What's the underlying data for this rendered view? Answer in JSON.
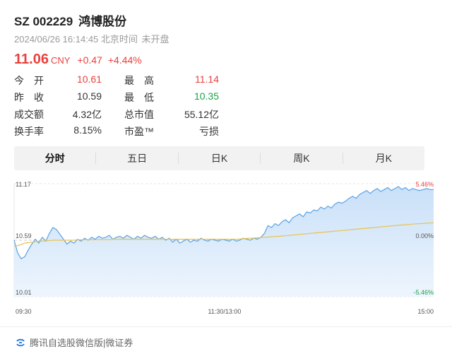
{
  "stock": {
    "code": "SZ 002229",
    "name": "鸿博股份",
    "timestamp": "2024/06/26 16:14:45 北京时间",
    "market_status": "未开盘",
    "price": "11.06",
    "currency": "CNY",
    "change": "+0.47",
    "change_pct": "+4.44%"
  },
  "stats": [
    {
      "label1": "今开",
      "value1": "10.61",
      "label2": "最高",
      "value2": "11.14"
    },
    {
      "label1": "昨收",
      "value1": "10.59",
      "label2": "最低",
      "value2": "10.35"
    },
    {
      "label1": "成交额",
      "value1": "4.32亿",
      "label2": "总市值",
      "value2": "55.12亿"
    },
    {
      "label1": "换手率",
      "value1": "8.15%",
      "label2": "市盈™",
      "value2": "亏损"
    }
  ],
  "tabs": [
    {
      "label": "分时",
      "active": true
    },
    {
      "label": "五日",
      "active": false
    },
    {
      "label": "日K",
      "active": false
    },
    {
      "label": "周K",
      "active": false
    },
    {
      "label": "月K",
      "active": false
    }
  ],
  "chart_data": {
    "type": "area",
    "y_left_ticks": [
      "11.17",
      "10.59",
      "10.01"
    ],
    "y_right_ticks": [
      "5.46%",
      "0.00%",
      "-5.46%"
    ],
    "x_ticks": [
      "09:30",
      "11:30/13:00",
      "15:00"
    ],
    "ylim": [
      10.01,
      11.17
    ],
    "price_series": [
      10.59,
      10.46,
      10.4,
      10.42,
      10.49,
      10.55,
      10.6,
      10.56,
      10.62,
      10.58,
      10.66,
      10.72,
      10.7,
      10.65,
      10.6,
      10.55,
      10.58,
      10.56,
      10.6,
      10.58,
      10.61,
      10.59,
      10.62,
      10.6,
      10.63,
      10.61,
      10.62,
      10.64,
      10.6,
      10.62,
      10.63,
      10.61,
      10.64,
      10.62,
      10.6,
      10.63,
      10.61,
      10.64,
      10.62,
      10.61,
      10.63,
      10.6,
      10.62,
      10.59,
      10.61,
      10.57,
      10.6,
      10.56,
      10.58,
      10.6,
      10.57,
      10.59,
      10.58,
      10.61,
      10.59,
      10.58,
      10.6,
      10.59,
      10.58,
      10.6,
      10.59,
      10.58,
      10.6,
      10.58,
      10.59,
      10.61,
      10.6,
      10.59,
      10.61,
      10.6,
      10.62,
      10.66,
      10.74,
      10.72,
      10.76,
      10.74,
      10.78,
      10.8,
      10.77,
      10.82,
      10.84,
      10.86,
      10.83,
      10.88,
      10.87,
      10.9,
      10.89,
      10.93,
      10.91,
      10.94,
      10.92,
      10.96,
      10.98,
      10.97,
      10.99,
      11.02,
      11.04,
      11.02,
      11.06,
      11.08,
      11.1,
      11.07,
      11.1,
      11.12,
      11.09,
      11.11,
      11.13,
      11.1,
      11.12,
      11.14,
      11.11,
      11.13,
      11.1,
      11.12,
      11.11,
      11.1,
      11.11,
      11.12,
      11.11,
      11.11
    ],
    "avg_series": [
      10.53,
      10.535,
      10.545,
      10.56,
      10.565,
      10.57,
      10.575,
      10.58,
      10.58,
      10.585,
      10.585,
      10.59,
      10.59,
      10.59,
      10.59,
      10.59,
      10.59,
      10.59,
      10.595,
      10.595,
      10.595,
      10.595,
      10.595,
      10.595,
      10.595,
      10.595,
      10.595,
      10.595,
      10.6,
      10.6,
      10.6,
      10.6,
      10.6,
      10.6,
      10.6,
      10.6,
      10.6,
      10.6,
      10.6,
      10.6,
      10.6,
      10.6,
      10.6,
      10.6,
      10.6,
      10.6,
      10.6,
      10.6,
      10.6,
      10.6,
      10.6,
      10.6,
      10.6,
      10.6,
      10.6,
      10.6,
      10.6,
      10.6,
      10.6,
      10.6,
      10.6,
      10.6,
      10.6,
      10.6,
      10.602,
      10.605,
      10.608,
      10.61,
      10.612,
      10.615,
      10.618,
      10.62,
      10.622,
      10.625,
      10.628,
      10.63,
      10.633,
      10.636,
      10.64,
      10.643,
      10.646,
      10.65,
      10.653,
      10.656,
      10.66,
      10.663,
      10.666,
      10.67,
      10.673,
      10.676,
      10.68,
      10.683,
      10.686,
      10.69,
      10.693,
      10.696,
      10.7,
      10.703,
      10.706,
      10.71,
      10.713,
      10.716,
      10.72,
      10.723,
      10.726,
      10.73,
      10.733,
      10.736,
      10.74,
      10.743,
      10.746,
      10.749,
      10.752,
      10.755,
      10.758,
      10.76,
      10.762,
      10.764,
      10.766,
      10.768
    ]
  },
  "footer": {
    "text": "腾讯自选股微信版|微证券"
  },
  "colors": {
    "up": "#e8413d",
    "down": "#1aa34a",
    "line": "#5aa2e6",
    "fill": "#dcebfb",
    "avg": "#e9c24b"
  }
}
